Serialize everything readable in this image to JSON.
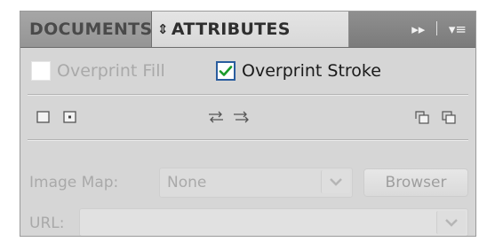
{
  "tabs": {
    "documents": "DOCUMENTS",
    "attributes": "ATTRIBUTES",
    "attributes_arrows": "⇕",
    "forward_glyph": "▸▸",
    "menu_glyph": "▾≡"
  },
  "checks": {
    "overprint_fill": "Overprint Fill",
    "overprint_fill_checked": false,
    "overprint_stroke": "Overprint Stroke",
    "overprint_stroke_checked": true
  },
  "imagemap": {
    "label": "Image Map:",
    "value": "None",
    "browser_button": "Browser"
  },
  "url": {
    "label": "URL:",
    "value": ""
  },
  "colors": {
    "panel_bg": "#d6d6d6",
    "disabled_text": "#a9a9a9",
    "check_accent": "#2a5d9e",
    "check_mark": "#1a9a2a"
  }
}
